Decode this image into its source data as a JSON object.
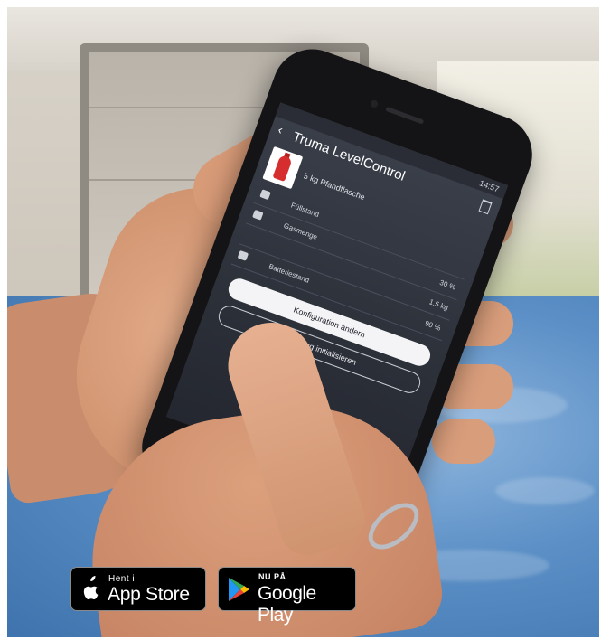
{
  "phone_app": {
    "status_time": "14:57",
    "title": "Truma LevelControl",
    "tank_label": "5 kg Pfandflasche",
    "rows": [
      {
        "label": "Füllstand",
        "value": ""
      },
      {
        "label": "Gasmenge",
        "value": "30 %"
      },
      {
        "label": "",
        "value": "1,5 kg"
      },
      {
        "label": "Batteriestand",
        "value": "90 %"
      }
    ],
    "button_primary": "Konfiguration ändern",
    "button_secondary": "Messung initialisieren"
  },
  "badges": {
    "app_store": {
      "small": "Hent i",
      "big": "App Store"
    },
    "google_play": {
      "small": "NU PÅ",
      "big": "Google Play"
    }
  },
  "colors": {
    "blanket": "#5b8fc6",
    "gas_bottle": "#d62e2e",
    "badge_bg": "#000000"
  }
}
